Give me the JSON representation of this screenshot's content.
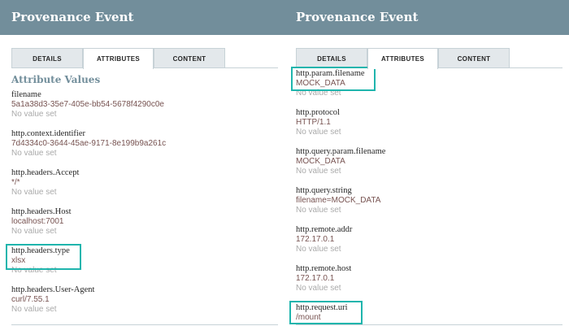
{
  "left": {
    "title": "Provenance Event",
    "tabs": [
      {
        "label": "DETAILS",
        "active": false
      },
      {
        "label": "ATTRIBUTES",
        "active": true
      },
      {
        "label": "CONTENT",
        "active": false
      }
    ],
    "section_title": "Attribute Values",
    "attributes": [
      {
        "name": "filename",
        "value": "5a1a38d3-35e7-405e-bb54-5678f4290c0e",
        "previous": "No value set",
        "highlighted": false
      },
      {
        "name": "http.context.identifier",
        "value": "7d4334c0-3644-45ae-9171-8e199b9a261c",
        "previous": "No value set",
        "highlighted": false
      },
      {
        "name": "http.headers.Accept",
        "value": "*/*",
        "previous": "No value set",
        "highlighted": false
      },
      {
        "name": "http.headers.Host",
        "value": "localhost:7001",
        "previous": "No value set",
        "highlighted": false
      },
      {
        "name": "http.headers.type",
        "value": "xlsx",
        "previous": "No value set",
        "highlighted": true
      },
      {
        "name": "http.headers.User-Agent",
        "value": "curl/7.55.1",
        "previous": "No value set",
        "highlighted": false
      }
    ]
  },
  "right": {
    "title": "Provenance Event",
    "tabs": [
      {
        "label": "DETAILS",
        "active": false
      },
      {
        "label": "ATTRIBUTES",
        "active": true
      },
      {
        "label": "CONTENT",
        "active": false
      }
    ],
    "attributes": [
      {
        "name": "http.param.filename",
        "value": "MOCK_DATA",
        "previous": "No value set",
        "highlighted": true
      },
      {
        "name": "http.protocol",
        "value": "HTTP/1.1",
        "previous": "No value set",
        "highlighted": false
      },
      {
        "name": "http.query.param.filename",
        "value": "MOCK_DATA",
        "previous": "No value set",
        "highlighted": false
      },
      {
        "name": "http.query.string",
        "value": "filename=MOCK_DATA",
        "previous": "No value set",
        "highlighted": false
      },
      {
        "name": "http.remote.addr",
        "value": "172.17.0.1",
        "previous": "No value set",
        "highlighted": false
      },
      {
        "name": "http.remote.host",
        "value": "172.17.0.1",
        "previous": "No value set",
        "highlighted": false
      },
      {
        "name": "http.request.uri",
        "value": "/mount",
        "previous": "",
        "highlighted": true
      }
    ]
  },
  "colors": {
    "header_bg": "#728e9b",
    "value_text": "#775351",
    "highlight_border": "#1fb5ad",
    "muted_text": "#aaaaaa"
  }
}
